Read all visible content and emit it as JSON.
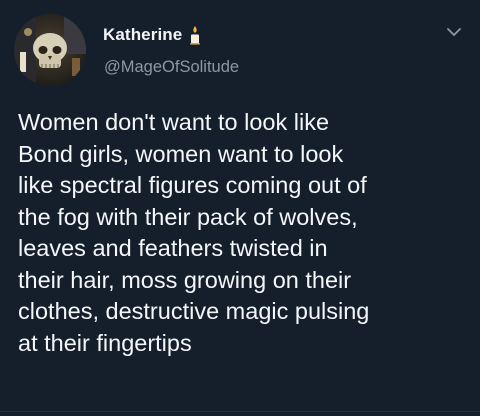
{
  "author": {
    "display_name": "Katherine",
    "handle": "@MageOfSolitude",
    "avatar_icon": "skull-avatar",
    "badge_icon": "candle-emoji-icon"
  },
  "tweet": {
    "text": "Women don't want to look like\nBond girls, women want to look\nlike spectral figures coming out of\nthe fog with their pack of wolves,\nleaves and feathers twisted in\ntheir hair, moss growing on their\nclothes, destructive magic pulsing\nat their fingertips"
  },
  "menu": {
    "icon": "chevron-down-icon"
  },
  "colors": {
    "background": "#151f2b",
    "text": "#f4f6f8",
    "secondary_text": "#8a98a6"
  }
}
